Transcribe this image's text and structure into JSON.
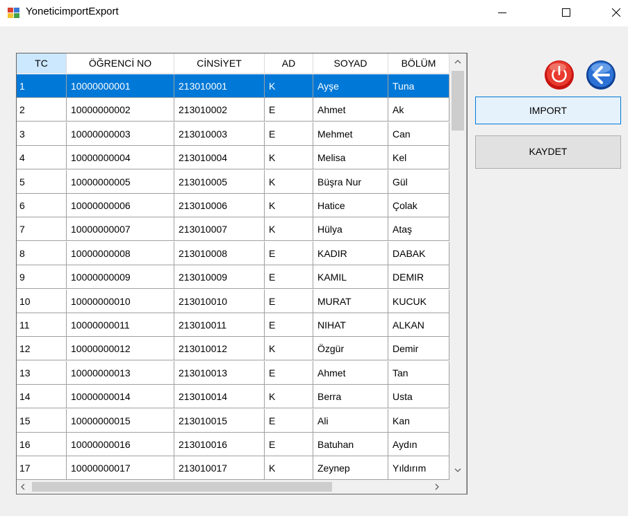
{
  "window": {
    "title": "YoneticimportExport"
  },
  "grid": {
    "columns": [
      "TC",
      "ÖĞRENCİ NO",
      "CİNSİYET",
      "AD",
      "SOYAD",
      "BÖLÜM"
    ],
    "selected_row_index": 0,
    "rows": [
      [
        "1",
        "10000000001",
        "213010001",
        "K",
        "Ayşe",
        "Tuna"
      ],
      [
        "2",
        "10000000002",
        "213010002",
        "E",
        "Ahmet",
        "Ak"
      ],
      [
        "3",
        "10000000003",
        "213010003",
        "E",
        "Mehmet",
        "Can"
      ],
      [
        "4",
        "10000000004",
        "213010004",
        "K",
        "Melisa",
        "Kel"
      ],
      [
        "5",
        "10000000005",
        "213010005",
        "K",
        "Büşra Nur",
        "Gül"
      ],
      [
        "6",
        "10000000006",
        "213010006",
        "K",
        "Hatice",
        "Çolak"
      ],
      [
        "7",
        "10000000007",
        "213010007",
        "K",
        "Hülya",
        "Ataş"
      ],
      [
        "8",
        "10000000008",
        "213010008",
        "E",
        "KADIR",
        "DABAK"
      ],
      [
        "9",
        "10000000009",
        "213010009",
        "E",
        "KAMIL",
        "DEMIR"
      ],
      [
        "10",
        "10000000010",
        "213010010",
        "E",
        "MURAT",
        "KUCUK"
      ],
      [
        "11",
        "10000000011",
        "213010011",
        "E",
        "NIHAT",
        "ALKAN"
      ],
      [
        "12",
        "10000000012",
        "213010012",
        "K",
        "Özgür",
        "Demir"
      ],
      [
        "13",
        "10000000013",
        "213010013",
        "E",
        "Ahmet",
        "Tan"
      ],
      [
        "14",
        "10000000014",
        "213010014",
        "K",
        "Berra",
        "Usta"
      ],
      [
        "15",
        "10000000015",
        "213010015",
        "E",
        "Ali",
        "Kan"
      ],
      [
        "16",
        "10000000016",
        "213010016",
        "E",
        "Batuhan",
        "Aydın"
      ],
      [
        "17",
        "10000000017",
        "213010017",
        "K",
        "Zeynep",
        "Yıldırım"
      ]
    ]
  },
  "buttons": {
    "import_label": "IMPORT",
    "kaydet_label": "KAYDET"
  },
  "icons": {
    "power": "power-icon",
    "back": "back-arrow-icon"
  },
  "colors": {
    "selection": "#0078d7",
    "header_selected": "#cce8ff",
    "power_red": "#e0201c",
    "back_blue": "#1f66c9"
  }
}
